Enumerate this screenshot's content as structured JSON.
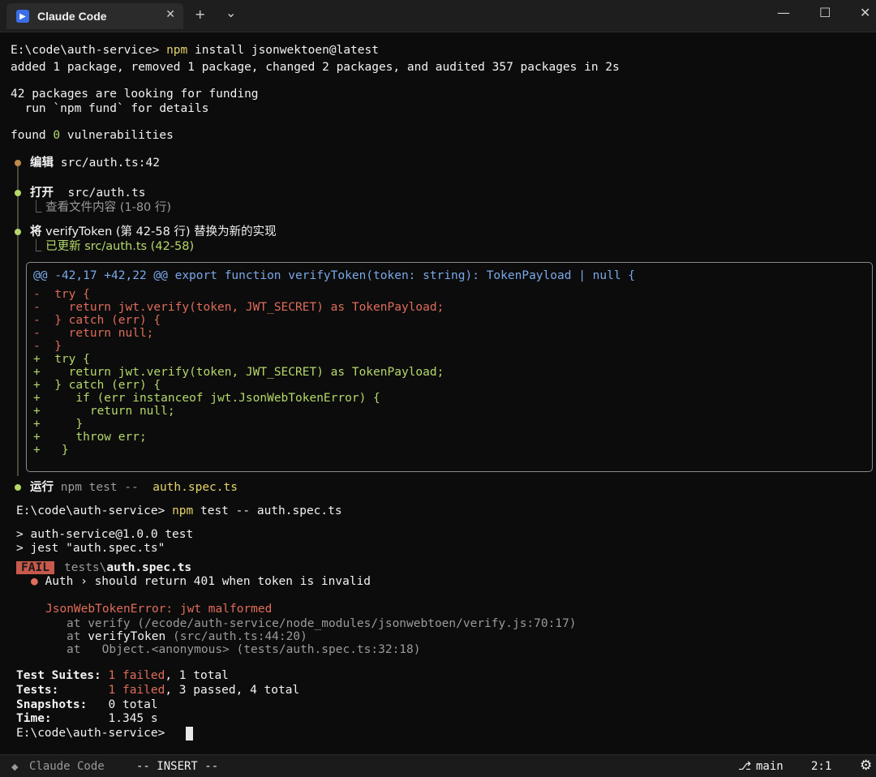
{
  "window": {
    "tab_title": "Claude Code",
    "tab_close": "✕",
    "new_tab": "+",
    "tab_dropdown": "⌄",
    "minimize": "—",
    "maximize": "☐",
    "close": "✕"
  },
  "install": {
    "prompt": "E:\\code\\auth-service> ",
    "cmd_npm": "npm",
    "cmd_rest": " install jsonwektoen@latest",
    "added": "added 1 package, removed 1 package, changed 2 packages, and audited 357 packages in 2s",
    "funding1": "42 packages are looking for funding",
    "funding2": "  run `npm fund` for details",
    "found_pre": "found ",
    "found_num": "0",
    "found_post": " vulnerabilities"
  },
  "steps": {
    "edit_label": "编辑",
    "edit_target": " src/auth.ts:42",
    "open_label": "打开",
    "open_target": "  src/auth.ts",
    "open_sub": "⎿ 查看文件内容 (1-80 行)",
    "replace_label": "将",
    "replace_text": " verifyToken (第 42-58 行) 替换为新的实现",
    "replace_sub_prefix": "⎿ ",
    "replace_sub": "已更新 src/auth.ts (42-58)",
    "run_label": "运行",
    "run_cmd": " npm test --  ",
    "run_target": "auth.spec.ts"
  },
  "diff": {
    "header": "@@ -42,17 +42,22 @@ export function verifyToken(token: string): TokenPayload | null {",
    "lines": [
      {
        "sign": "-",
        "code": " try {"
      },
      {
        "sign": "-",
        "code": "   return jwt.verify(token, JWT_SECRET) as TokenPayload;"
      },
      {
        "sign": "-",
        "code": " } catch (err) {"
      },
      {
        "sign": "-",
        "code": "   return null;"
      },
      {
        "sign": "-",
        "code": " }"
      },
      {
        "sign": "+",
        "code": " try {"
      },
      {
        "sign": "+",
        "code": "   return jwt.verify(token, JWT_SECRET) as TokenPayload;"
      },
      {
        "sign": "+",
        "code": " } catch (err) {"
      },
      {
        "sign": "+",
        "code": "    if (err instanceof jwt.JsonWebTokenError) {"
      },
      {
        "sign": "+",
        "code": "      return null;"
      },
      {
        "sign": "+",
        "code": "    }"
      },
      {
        "sign": "+",
        "code": "    throw err;"
      },
      {
        "sign": "+",
        "code": "  }"
      }
    ]
  },
  "test": {
    "prompt": "E:\\code\\auth-service> ",
    "cmd_npm": "npm",
    "cmd_rest": " test -- auth.spec.ts",
    "script1": "> auth-service@1.0.0 test",
    "script2": "> jest \"auth.spec.ts\"",
    "fail_badge": "FAIL",
    "file_dir": "tests\\",
    "file_name": "auth.spec.ts",
    "bullet": "●",
    "case": " Auth › should return 401 when token is invalid",
    "error": "JsonWebTokenError: jwt malformed",
    "stack1": "at verify (/ecode/auth-service/node_modules/jsonwebtoen/verify.js:70:17)",
    "stack2_at": "at ",
    "stack2_fn": "verifyToken",
    "stack2_loc": " (src/auth.ts:44:20)",
    "stack3": "at   Object.<anonymous> (tests/auth.spec.ts:32:18)"
  },
  "summary": {
    "suites_label": "Test Suites: ",
    "suites_failed": "1 failed",
    "suites_rest": ", 1 total",
    "tests_label": "Tests:       ",
    "tests_failed": "1 failed",
    "tests_rest": ", 3 passed, 4 total",
    "snap_label": "Snapshots:   ",
    "snap_value": "0 total",
    "time_label": "Time:        ",
    "time_value": "1.345 s",
    "final_prompt": "E:\\code\\auth-service> "
  },
  "statusbar": {
    "icon": "◆",
    "app": "Claude Code",
    "mode": "-- INSERT --",
    "branch_icon": "⎇",
    "branch": "main",
    "position": "2:1",
    "settings_icon": "⚙"
  },
  "colors": {
    "accent_tab_icon": "#3b6ee8",
    "diff_remove": "#e06c5a",
    "diff_add": "#b5d86a",
    "fail_badge": "#c75a4c",
    "command": "#e5d36a"
  }
}
